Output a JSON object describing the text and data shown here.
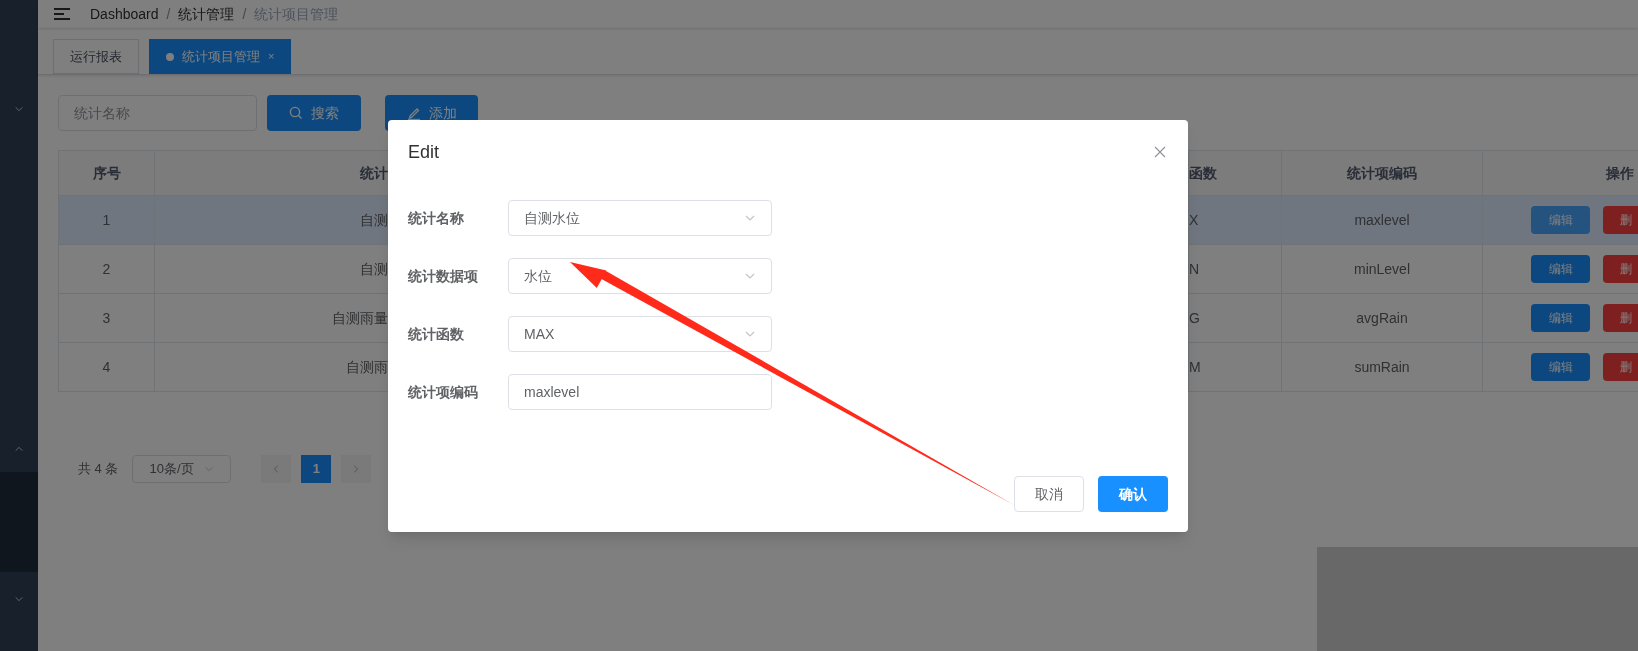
{
  "breadcrumb": [
    "Dashboard",
    "统计管理",
    "统计项目管理"
  ],
  "breadcrumb_separator": "/",
  "tabs": [
    {
      "label": "运行报表",
      "selected": false
    },
    {
      "label": "统计项目管理",
      "selected": true,
      "close": "×"
    }
  ],
  "search": {
    "placeholder": "统计名称",
    "search_button": "搜索",
    "add_button": "添加"
  },
  "table": {
    "columns": [
      "序号",
      "统计",
      "函数",
      "统计项编码",
      "操作"
    ],
    "rows": [
      {
        "index": "1",
        "name": "自测",
        "function": "X",
        "code": "maxlevel",
        "selected": true,
        "actions": [
          "编辑",
          "删"
        ]
      },
      {
        "index": "2",
        "name": "自测",
        "function": "N",
        "code": "minLevel",
        "selected": false,
        "actions": [
          "编辑",
          "删"
        ]
      },
      {
        "index": "3",
        "name": "自测雨量",
        "function": "G",
        "code": "avgRain",
        "selected": false,
        "actions": [
          "编辑",
          "删"
        ]
      },
      {
        "index": "4",
        "name": "自测雨",
        "function": "M",
        "code": "sumRain",
        "selected": false,
        "actions": [
          "编辑",
          "删"
        ]
      }
    ]
  },
  "pagination": {
    "total": "共 4 条",
    "page_size": "10条/页",
    "pages": [
      {
        "label": "1",
        "selected": true
      }
    ]
  },
  "dialog": {
    "title": "Edit",
    "fields": [
      {
        "label": "统计名称",
        "kind": "select",
        "value": "自测水位"
      },
      {
        "label": "统计数据项",
        "kind": "select",
        "value": "水位"
      },
      {
        "label": "统计函数",
        "kind": "select",
        "value": "MAX"
      },
      {
        "label": "统计项编码",
        "kind": "input",
        "value": "maxlevel"
      }
    ],
    "buttons": [
      {
        "label": "取消",
        "kind": "secondary"
      },
      {
        "label": "确认",
        "kind": "primary"
      }
    ]
  }
}
